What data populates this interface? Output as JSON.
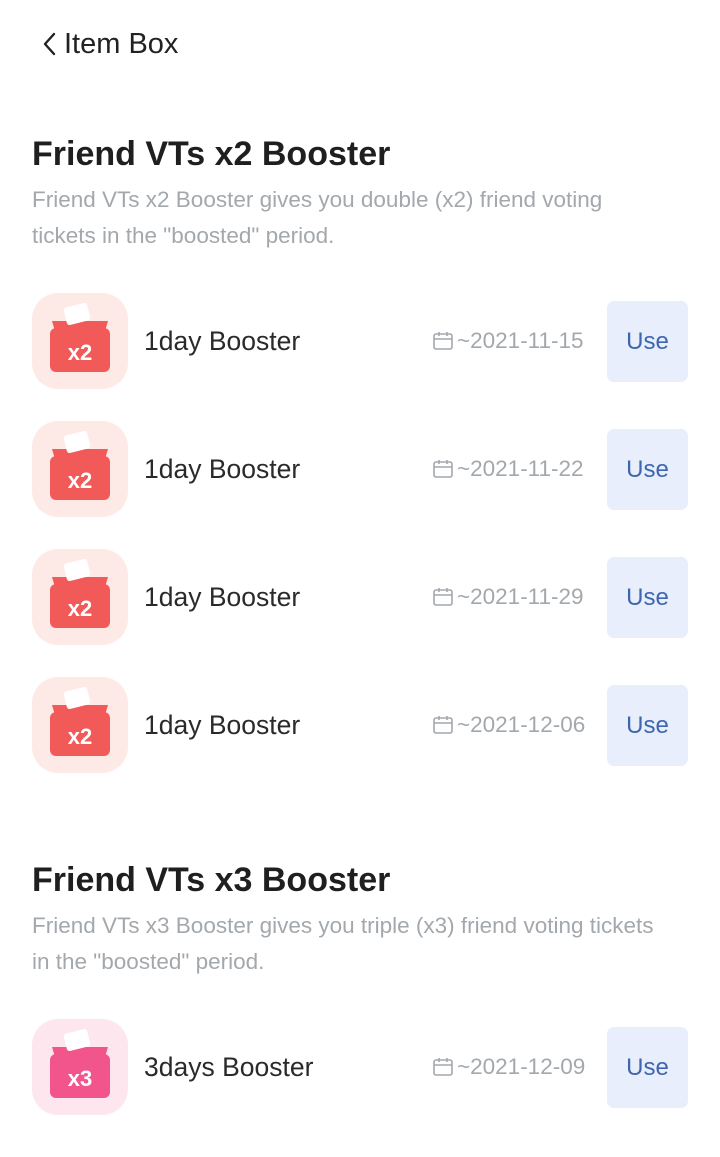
{
  "header": {
    "back_icon": "chevron-left-icon",
    "title": "Item Box"
  },
  "colors": {
    "x2_icon_bg": "#fde9e6",
    "x2_box": "#f25a5a",
    "x3_icon_bg": "#fde6ee",
    "x3_box": "#f2558c",
    "use_button_bg": "#e8eefb",
    "use_button_text": "#3e65b0",
    "muted_text": "#a3a8ad"
  },
  "sections": [
    {
      "title": "Friend VTs x2 Booster",
      "description": "Friend VTs x2 Booster gives you double (x2) friend voting tickets in the \"boosted\" period.",
      "items": [
        {
          "icon": "ballot-box-x2-icon",
          "badge": "x2",
          "name": "1day Booster",
          "expiry_icon": "calendar-icon",
          "expiry": "~2021-11-15",
          "button": "Use"
        },
        {
          "icon": "ballot-box-x2-icon",
          "badge": "x2",
          "name": "1day Booster",
          "expiry_icon": "calendar-icon",
          "expiry": "~2021-11-22",
          "button": "Use"
        },
        {
          "icon": "ballot-box-x2-icon",
          "badge": "x2",
          "name": "1day Booster",
          "expiry_icon": "calendar-icon",
          "expiry": "~2021-11-29",
          "button": "Use"
        },
        {
          "icon": "ballot-box-x2-icon",
          "badge": "x2",
          "name": "1day Booster",
          "expiry_icon": "calendar-icon",
          "expiry": "~2021-12-06",
          "button": "Use"
        }
      ]
    },
    {
      "title": "Friend VTs x3 Booster",
      "description": "Friend VTs x3 Booster gives you triple (x3) friend voting tickets in the \"boosted\" period.",
      "items": [
        {
          "icon": "ballot-box-x3-icon",
          "badge": "x3",
          "name": "3days Booster",
          "expiry_icon": "calendar-icon",
          "expiry": "~2021-12-09",
          "button": "Use"
        }
      ]
    }
  ]
}
